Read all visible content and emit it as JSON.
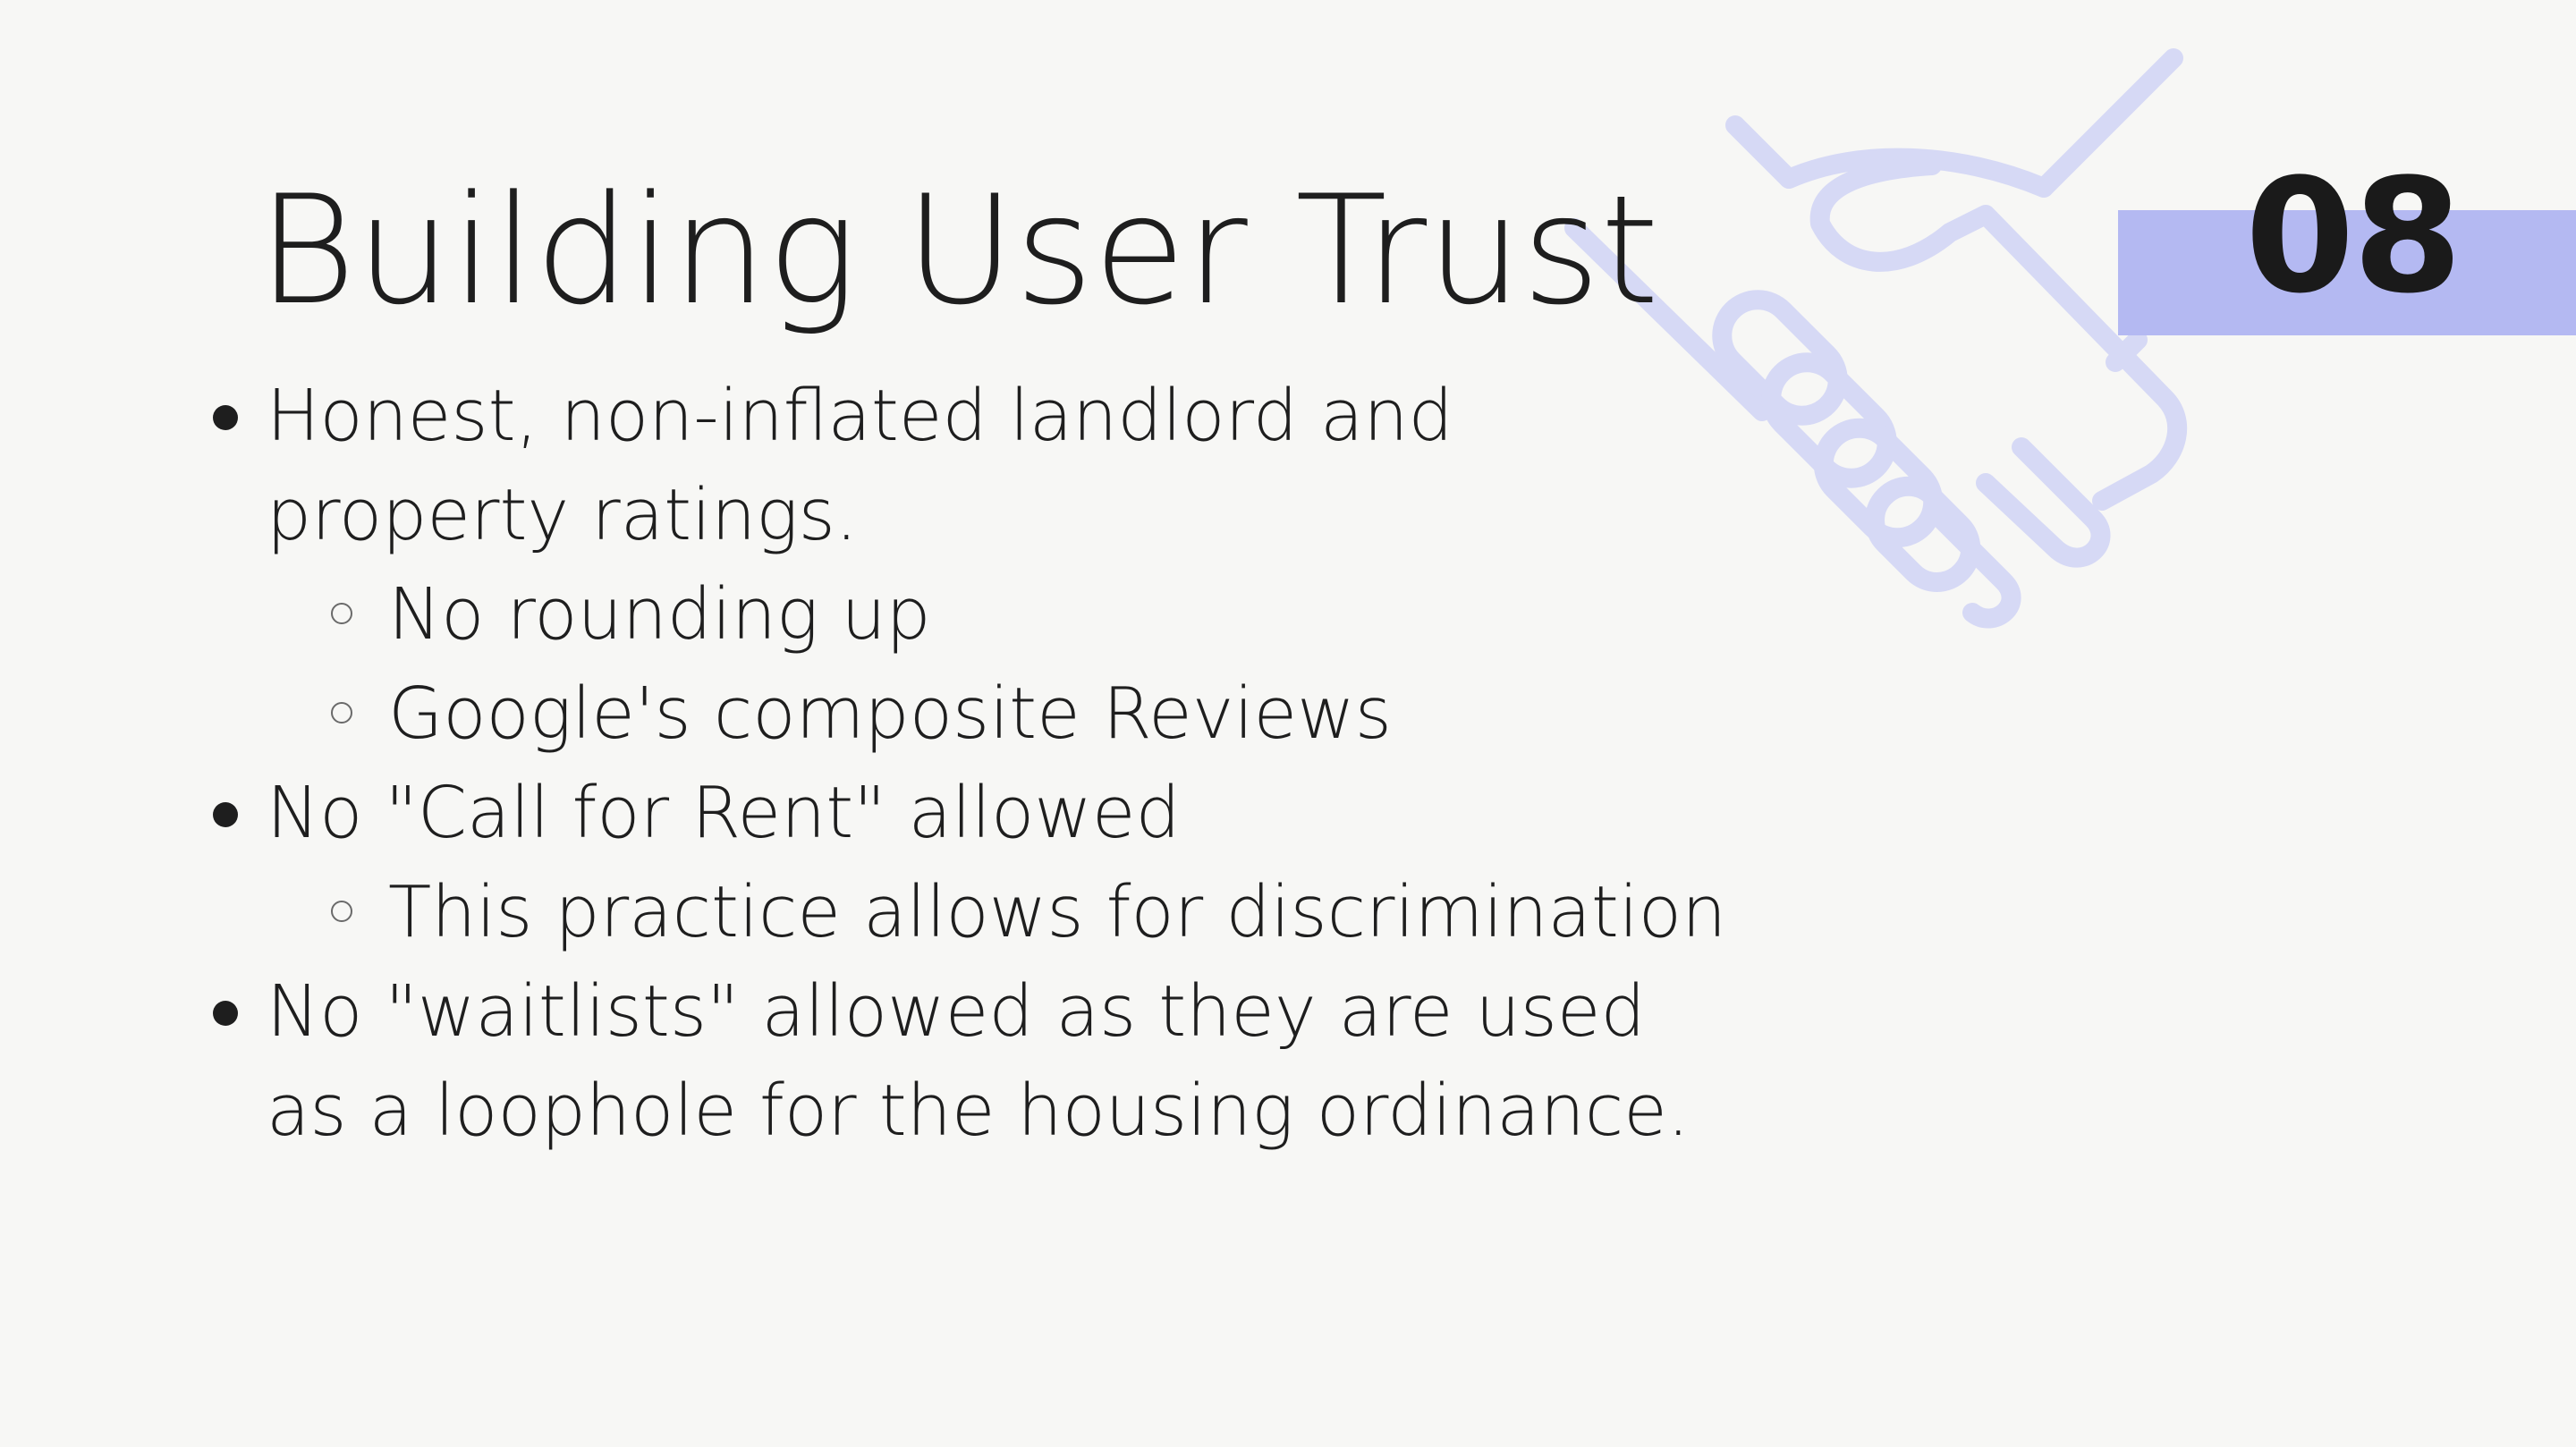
{
  "slide": {
    "title": "Building User Trust",
    "number": "08",
    "decoration_icon": "handshake-icon",
    "colors": {
      "background": "#f7f7f5",
      "accent_band": "#b4b9f2",
      "icon": "#d6d9f5",
      "text": "#1e1e1e"
    },
    "bullets": [
      {
        "text": "Honest, non-inflated landlord and property ratings.",
        "subbullets": [
          "No rounding up",
          "Google's composite Reviews"
        ]
      },
      {
        "text": "No \"Call for Rent\" allowed",
        "subbullets": [
          "This practice allows for discrimination"
        ]
      },
      {
        "text": "No \"waitlists\" allowed as they are used as a loophole for the housing ordinance.",
        "subbullets": []
      }
    ]
  }
}
